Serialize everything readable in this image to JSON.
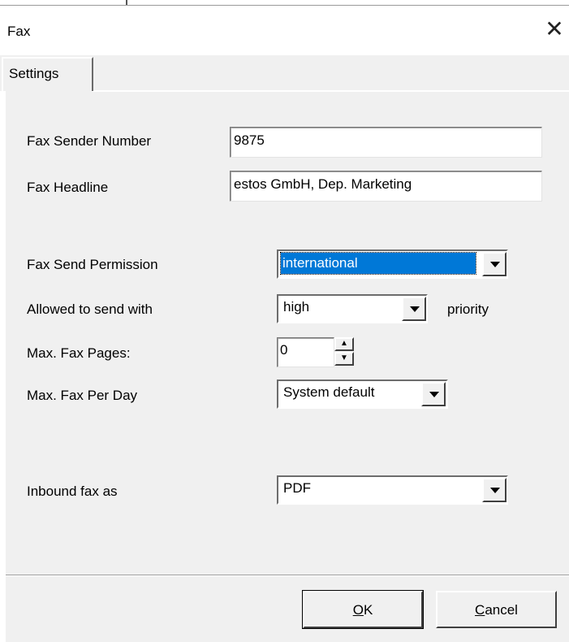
{
  "window": {
    "title": "Fax",
    "close_glyph": "✕"
  },
  "tabs": [
    {
      "label": "Settings",
      "active": true
    }
  ],
  "settings": {
    "fax_sender_number": {
      "label": "Fax Sender Number",
      "value": "9875"
    },
    "fax_headline": {
      "label": "Fax Headline",
      "value": "estos GmbH, Dep. Marketing"
    },
    "fax_send_permission": {
      "label": "Fax Send Permission",
      "selected": "international"
    },
    "allowed_to_send_with": {
      "label": "Allowed to send with",
      "selected": "high",
      "suffix": "priority"
    },
    "max_fax_pages": {
      "label": "Max. Fax Pages:",
      "value": "0"
    },
    "max_fax_per_day": {
      "label": "Max. Fax Per Day",
      "selected": "System default"
    },
    "inbound_fax_as": {
      "label": "Inbound fax as",
      "selected": "PDF"
    }
  },
  "buttons": {
    "ok": {
      "mnemonic": "O",
      "rest": "K"
    },
    "cancel": {
      "mnemonic": "C",
      "rest": "ancel"
    }
  },
  "colors": {
    "selection": "#0078d7",
    "face": "#f0f0f0"
  }
}
